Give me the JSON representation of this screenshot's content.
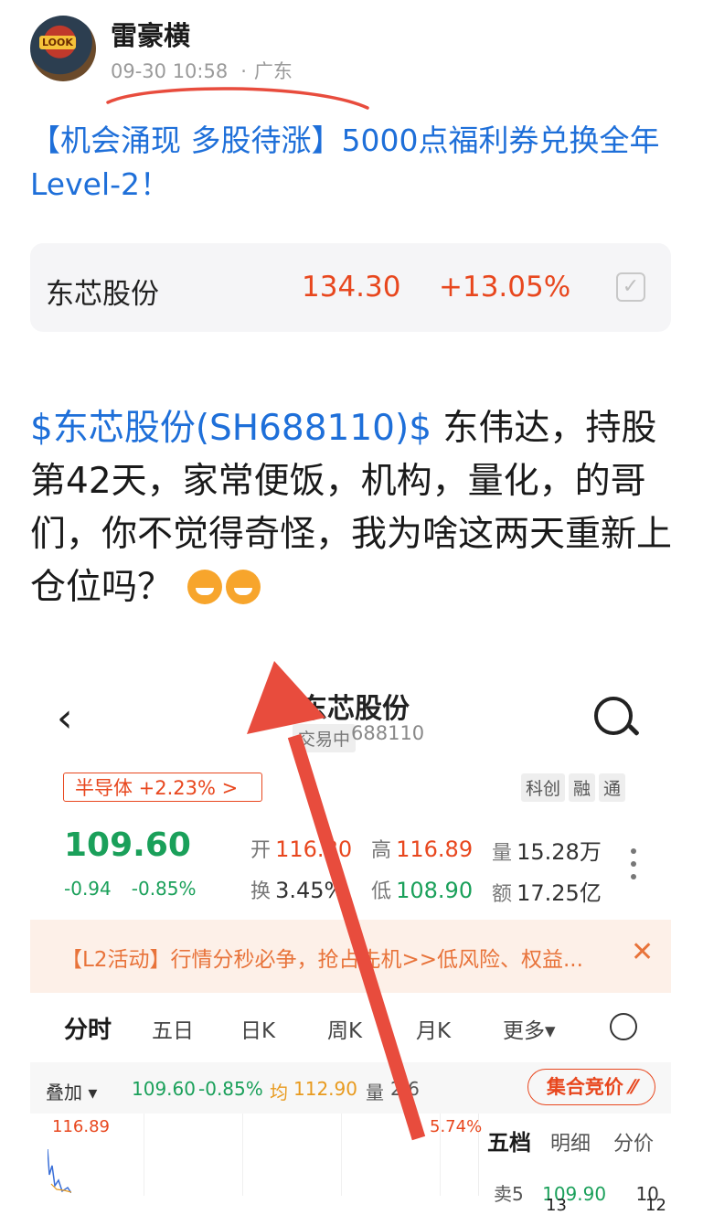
{
  "post": {
    "username": "雷豪横",
    "avatar_label": "LOOK",
    "timestamp": "09-30 10:58",
    "location_sep": "·",
    "location": "广东",
    "title": "【机会涌现 多股待涨】5000点福利券兑换全年Level-2！"
  },
  "stock_card": {
    "name": "东芯股份",
    "price": "134.30",
    "change": "+13.05%",
    "checkbox_icon": "check-icon"
  },
  "body": {
    "cashtag": "$东芯股份(SH688110)$",
    "text": " 东伟达，持股第42天，家常便饭，机构，量化，的哥们，你不觉得奇怪，我为啥这两天重新上仓位吗？"
  },
  "embedded": {
    "back_icon": "‹",
    "stock_name": "东芯股份",
    "status": "交易中",
    "code": "688110",
    "sector_tag": "半导体 +2.23%  >",
    "tags": [
      "科创",
      "融",
      "通"
    ],
    "price": "109.60",
    "change_abs": "-0.94",
    "change_pct": "-0.85%",
    "quote": {
      "open_label": "开",
      "open": "116.80",
      "high_label": "高",
      "high": "116.89",
      "volume_label": "量",
      "volume": "15.28万",
      "turnover_label": "换",
      "turnover": "3.45%",
      "low_label": "低",
      "low": "108.90",
      "amount_label": "额",
      "amount": "17.25亿"
    },
    "banner": {
      "text": "【L2活动】行情分秒必争，抢占先机>>低风险、权益...",
      "close": "✕"
    },
    "tabs": [
      "分时",
      "五日",
      "日K",
      "周K",
      "月K",
      "更多▾"
    ],
    "overlay": {
      "label": "叠加 ▾",
      "price": "109.60",
      "pct": "-0.85%",
      "avg_label": "均",
      "avg": "112.90",
      "vol_label": "量",
      "vol": "2.6",
      "auction_button": "集合竞价 ⁄⁄"
    },
    "chart": {
      "high": "116.89",
      "pct": "5.74%"
    },
    "side_tabs": [
      "五档",
      "明细",
      "分价"
    ],
    "side_row": {
      "label": "卖5",
      "price": "109.90",
      "vol": "10"
    },
    "footer_nums": [
      "13",
      "12"
    ]
  },
  "colors": {
    "link_blue": "#1e6fd9",
    "up_red": "#e8471e",
    "down_green": "#1aa05a",
    "annotation_red": "#e84c3d"
  }
}
